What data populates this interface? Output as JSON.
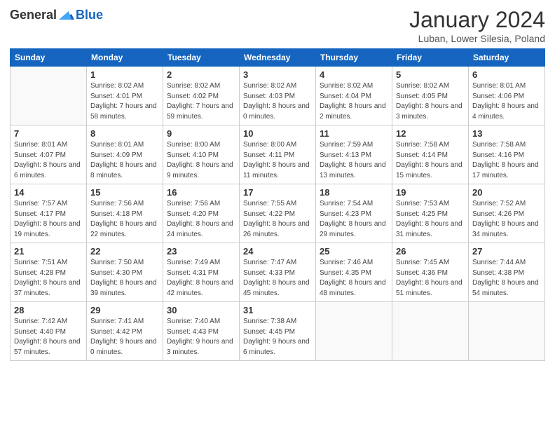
{
  "header": {
    "logo_general": "General",
    "logo_blue": "Blue",
    "month_year": "January 2024",
    "location": "Luban, Lower Silesia, Poland"
  },
  "days_of_week": [
    "Sunday",
    "Monday",
    "Tuesday",
    "Wednesday",
    "Thursday",
    "Friday",
    "Saturday"
  ],
  "weeks": [
    [
      {
        "day": "",
        "sunrise": "",
        "sunset": "",
        "daylight": ""
      },
      {
        "day": "1",
        "sunrise": "Sunrise: 8:02 AM",
        "sunset": "Sunset: 4:01 PM",
        "daylight": "Daylight: 7 hours and 58 minutes."
      },
      {
        "day": "2",
        "sunrise": "Sunrise: 8:02 AM",
        "sunset": "Sunset: 4:02 PM",
        "daylight": "Daylight: 7 hours and 59 minutes."
      },
      {
        "day": "3",
        "sunrise": "Sunrise: 8:02 AM",
        "sunset": "Sunset: 4:03 PM",
        "daylight": "Daylight: 8 hours and 0 minutes."
      },
      {
        "day": "4",
        "sunrise": "Sunrise: 8:02 AM",
        "sunset": "Sunset: 4:04 PM",
        "daylight": "Daylight: 8 hours and 2 minutes."
      },
      {
        "day": "5",
        "sunrise": "Sunrise: 8:02 AM",
        "sunset": "Sunset: 4:05 PM",
        "daylight": "Daylight: 8 hours and 3 minutes."
      },
      {
        "day": "6",
        "sunrise": "Sunrise: 8:01 AM",
        "sunset": "Sunset: 4:06 PM",
        "daylight": "Daylight: 8 hours and 4 minutes."
      }
    ],
    [
      {
        "day": "7",
        "sunrise": "Sunrise: 8:01 AM",
        "sunset": "Sunset: 4:07 PM",
        "daylight": "Daylight: 8 hours and 6 minutes."
      },
      {
        "day": "8",
        "sunrise": "Sunrise: 8:01 AM",
        "sunset": "Sunset: 4:09 PM",
        "daylight": "Daylight: 8 hours and 8 minutes."
      },
      {
        "day": "9",
        "sunrise": "Sunrise: 8:00 AM",
        "sunset": "Sunset: 4:10 PM",
        "daylight": "Daylight: 8 hours and 9 minutes."
      },
      {
        "day": "10",
        "sunrise": "Sunrise: 8:00 AM",
        "sunset": "Sunset: 4:11 PM",
        "daylight": "Daylight: 8 hours and 11 minutes."
      },
      {
        "day": "11",
        "sunrise": "Sunrise: 7:59 AM",
        "sunset": "Sunset: 4:13 PM",
        "daylight": "Daylight: 8 hours and 13 minutes."
      },
      {
        "day": "12",
        "sunrise": "Sunrise: 7:58 AM",
        "sunset": "Sunset: 4:14 PM",
        "daylight": "Daylight: 8 hours and 15 minutes."
      },
      {
        "day": "13",
        "sunrise": "Sunrise: 7:58 AM",
        "sunset": "Sunset: 4:16 PM",
        "daylight": "Daylight: 8 hours and 17 minutes."
      }
    ],
    [
      {
        "day": "14",
        "sunrise": "Sunrise: 7:57 AM",
        "sunset": "Sunset: 4:17 PM",
        "daylight": "Daylight: 8 hours and 19 minutes."
      },
      {
        "day": "15",
        "sunrise": "Sunrise: 7:56 AM",
        "sunset": "Sunset: 4:18 PM",
        "daylight": "Daylight: 8 hours and 22 minutes."
      },
      {
        "day": "16",
        "sunrise": "Sunrise: 7:56 AM",
        "sunset": "Sunset: 4:20 PM",
        "daylight": "Daylight: 8 hours and 24 minutes."
      },
      {
        "day": "17",
        "sunrise": "Sunrise: 7:55 AM",
        "sunset": "Sunset: 4:22 PM",
        "daylight": "Daylight: 8 hours and 26 minutes."
      },
      {
        "day": "18",
        "sunrise": "Sunrise: 7:54 AM",
        "sunset": "Sunset: 4:23 PM",
        "daylight": "Daylight: 8 hours and 29 minutes."
      },
      {
        "day": "19",
        "sunrise": "Sunrise: 7:53 AM",
        "sunset": "Sunset: 4:25 PM",
        "daylight": "Daylight: 8 hours and 31 minutes."
      },
      {
        "day": "20",
        "sunrise": "Sunrise: 7:52 AM",
        "sunset": "Sunset: 4:26 PM",
        "daylight": "Daylight: 8 hours and 34 minutes."
      }
    ],
    [
      {
        "day": "21",
        "sunrise": "Sunrise: 7:51 AM",
        "sunset": "Sunset: 4:28 PM",
        "daylight": "Daylight: 8 hours and 37 minutes."
      },
      {
        "day": "22",
        "sunrise": "Sunrise: 7:50 AM",
        "sunset": "Sunset: 4:30 PM",
        "daylight": "Daylight: 8 hours and 39 minutes."
      },
      {
        "day": "23",
        "sunrise": "Sunrise: 7:49 AM",
        "sunset": "Sunset: 4:31 PM",
        "daylight": "Daylight: 8 hours and 42 minutes."
      },
      {
        "day": "24",
        "sunrise": "Sunrise: 7:47 AM",
        "sunset": "Sunset: 4:33 PM",
        "daylight": "Daylight: 8 hours and 45 minutes."
      },
      {
        "day": "25",
        "sunrise": "Sunrise: 7:46 AM",
        "sunset": "Sunset: 4:35 PM",
        "daylight": "Daylight: 8 hours and 48 minutes."
      },
      {
        "day": "26",
        "sunrise": "Sunrise: 7:45 AM",
        "sunset": "Sunset: 4:36 PM",
        "daylight": "Daylight: 8 hours and 51 minutes."
      },
      {
        "day": "27",
        "sunrise": "Sunrise: 7:44 AM",
        "sunset": "Sunset: 4:38 PM",
        "daylight": "Daylight: 8 hours and 54 minutes."
      }
    ],
    [
      {
        "day": "28",
        "sunrise": "Sunrise: 7:42 AM",
        "sunset": "Sunset: 4:40 PM",
        "daylight": "Daylight: 8 hours and 57 minutes."
      },
      {
        "day": "29",
        "sunrise": "Sunrise: 7:41 AM",
        "sunset": "Sunset: 4:42 PM",
        "daylight": "Daylight: 9 hours and 0 minutes."
      },
      {
        "day": "30",
        "sunrise": "Sunrise: 7:40 AM",
        "sunset": "Sunset: 4:43 PM",
        "daylight": "Daylight: 9 hours and 3 minutes."
      },
      {
        "day": "31",
        "sunrise": "Sunrise: 7:38 AM",
        "sunset": "Sunset: 4:45 PM",
        "daylight": "Daylight: 9 hours and 6 minutes."
      },
      {
        "day": "",
        "sunrise": "",
        "sunset": "",
        "daylight": ""
      },
      {
        "day": "",
        "sunrise": "",
        "sunset": "",
        "daylight": ""
      },
      {
        "day": "",
        "sunrise": "",
        "sunset": "",
        "daylight": ""
      }
    ]
  ]
}
